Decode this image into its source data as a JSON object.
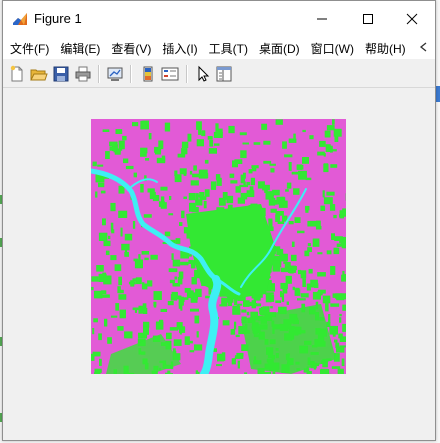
{
  "window": {
    "title": "Figure 1",
    "icon": "matlab-figure-icon",
    "controls": [
      "minimize-icon",
      "maximize-icon",
      "close-icon"
    ]
  },
  "menu": {
    "items": [
      "文件(F)",
      "编辑(E)",
      "查看(V)",
      "插入(I)",
      "工具(T)",
      "桌面(D)",
      "窗口(W)",
      "帮助(H)"
    ],
    "pin_icon": "dock-arrow-icon"
  },
  "toolbar": {
    "buttons": [
      "new-figure-icon",
      "open-file-icon",
      "save-icon",
      "print-icon",
      "link-plot-icon",
      "colorbar-icon",
      "legend-icon",
      "pointer-icon",
      "property-inspector-icon"
    ]
  },
  "figure": {
    "content": "classified-land-cover-image",
    "colors": {
      "vegetation": "#33e833",
      "urban": "#e25ad6",
      "water": "#3ef0f4",
      "background": "#f0f0f0"
    }
  }
}
